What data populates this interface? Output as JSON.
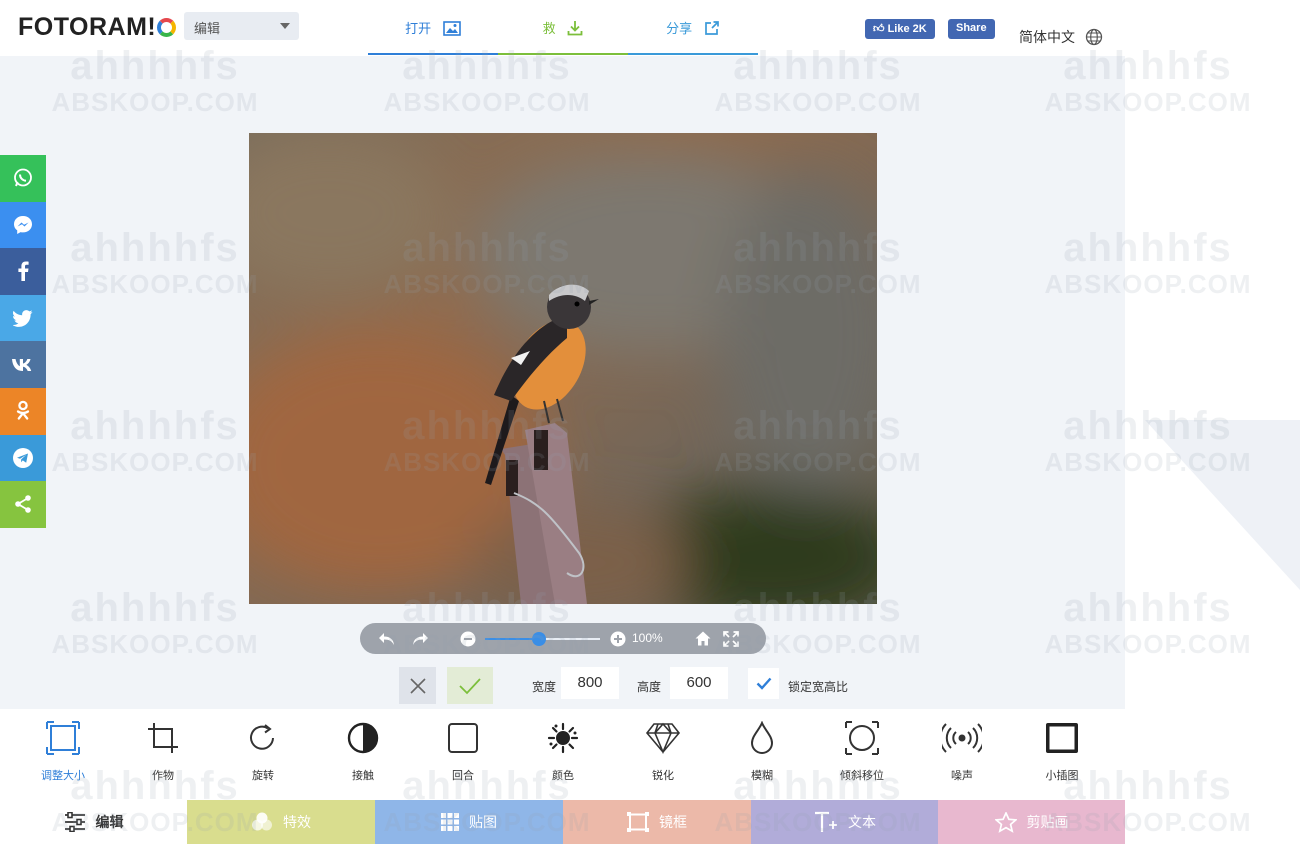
{
  "header": {
    "logo_text": "FOTORAM!",
    "mode_value": "编辑",
    "nav": [
      {
        "label": "打开",
        "color": "#2f7fd8"
      },
      {
        "label": "救",
        "color": "#7cbf3b"
      },
      {
        "label": "分享",
        "color": "#3a9ad9"
      }
    ],
    "fb_like": "Like 2K",
    "fb_share": "Share",
    "language": "简体中文"
  },
  "social": [
    {
      "name": "whatsapp",
      "color": "#35c15a"
    },
    {
      "name": "messenger",
      "color": "#3b8ff0"
    },
    {
      "name": "facebook",
      "color": "#3b5e9c"
    },
    {
      "name": "twitter",
      "color": "#4aa8e7"
    },
    {
      "name": "vk",
      "color": "#4d73a0"
    },
    {
      "name": "odnoklassniki",
      "color": "#ec8527"
    },
    {
      "name": "telegram",
      "color": "#3a9ad9"
    },
    {
      "name": "share",
      "color": "#86c43f"
    }
  ],
  "zoom": {
    "value": "100%",
    "slider_fraction": 0.47
  },
  "resize": {
    "width_label": "宽度",
    "width_value": "800",
    "height_label": "高度",
    "height_value": "600",
    "lock_label": "锁定宽高比",
    "lock_checked": true
  },
  "tools": [
    {
      "label": "调整大小",
      "icon": "resize-icon",
      "active": true
    },
    {
      "label": "作物",
      "icon": "crop-icon"
    },
    {
      "label": "旋转",
      "icon": "rotate-icon"
    },
    {
      "label": "接触",
      "icon": "contrast-icon"
    },
    {
      "label": "回合",
      "icon": "round-corner-icon"
    },
    {
      "label": "颜色",
      "icon": "color-splash-icon"
    },
    {
      "label": "锐化",
      "icon": "diamond-icon"
    },
    {
      "label": "模糊",
      "icon": "droplet-icon"
    },
    {
      "label": "倾斜移位",
      "icon": "tilt-shift-icon"
    },
    {
      "label": "噪声",
      "icon": "noise-icon"
    },
    {
      "label": "小插图",
      "icon": "vignette-icon"
    }
  ],
  "tabs": [
    {
      "label": "编辑",
      "icon": "sliders-icon"
    },
    {
      "label": "特效",
      "icon": "effects-icon"
    },
    {
      "label": "贴图",
      "icon": "grid-icon"
    },
    {
      "label": "镜框",
      "icon": "frame-icon"
    },
    {
      "label": "文本",
      "icon": "text-icon"
    },
    {
      "label": "剪贴画",
      "icon": "star-icon"
    }
  ],
  "watermark": {
    "line1": "ahhhhfs",
    "line2": "ABSKOOP.COM"
  }
}
